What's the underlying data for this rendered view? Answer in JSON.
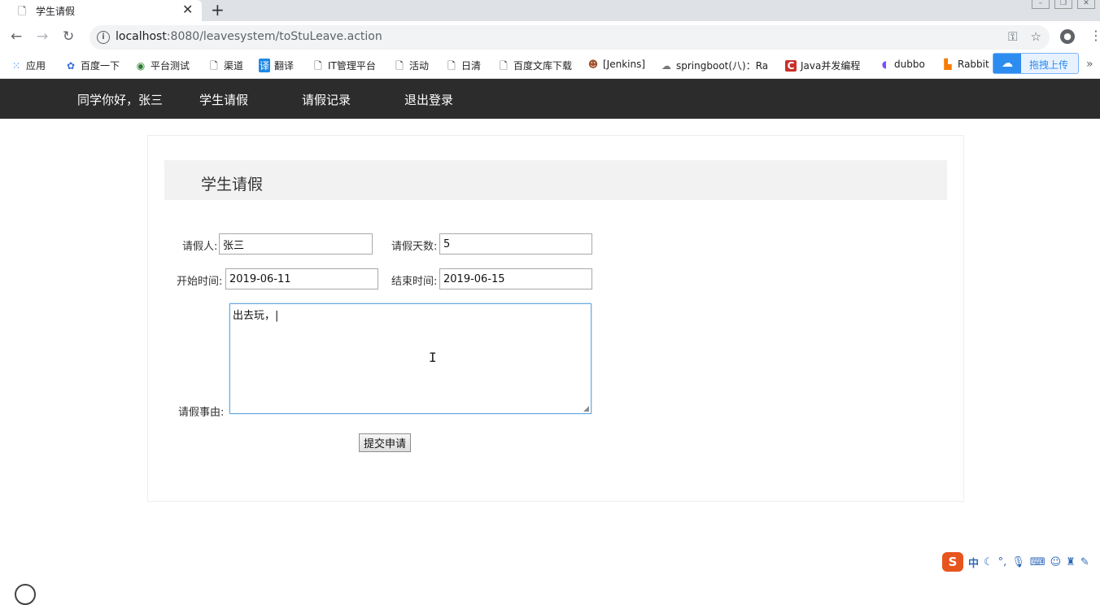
{
  "browser": {
    "tab_title": "学生请假",
    "url_host": "localhost",
    "url_rest": ":8080/leavesystem/toStuLeave.action",
    "bookmarks": [
      {
        "label": "应用",
        "icon": "apps-grid-icon"
      },
      {
        "label": "百度一下",
        "icon": "baidu-paw-icon"
      },
      {
        "label": "平台测试",
        "icon": "platform-icon"
      },
      {
        "label": "渠道",
        "icon": "page-icon"
      },
      {
        "label": "翻译",
        "icon": "translate-icon",
        "glyph": "译"
      },
      {
        "label": "IT管理平台",
        "icon": "page-icon"
      },
      {
        "label": "活动",
        "icon": "page-icon"
      },
      {
        "label": "日清",
        "icon": "page-icon"
      },
      {
        "label": "百度文库下载",
        "icon": "page-icon"
      },
      {
        "label": "[Jenkins]",
        "icon": "jenkins-icon"
      },
      {
        "label": "springboot(八)：Ra",
        "icon": "ghost-icon"
      },
      {
        "label": "Java并发编程",
        "icon": "csdn-icon",
        "glyph": "C"
      },
      {
        "label": "dubbo",
        "icon": "dubbo-icon"
      },
      {
        "label": "Rabbit",
        "icon": "rabbit-icon"
      }
    ],
    "upload_label": "拖拽上传"
  },
  "nav": {
    "greeting": "同学你好，张三",
    "items": [
      "学生请假",
      "请假记录",
      "退出登录"
    ]
  },
  "form": {
    "title": "学生请假",
    "applicant_label": "请假人:",
    "applicant_value": "张三",
    "days_label": "请假天数:",
    "days_value": "5",
    "start_label": "开始时间:",
    "start_value": "2019-06-11",
    "end_label": "结束时间:",
    "end_value": "2019-06-15",
    "reason_label": "请假事由:",
    "reason_value": "出去玩，|",
    "submit_label": "提交申请"
  },
  "ime": {
    "logo": "S",
    "mode": "中"
  }
}
